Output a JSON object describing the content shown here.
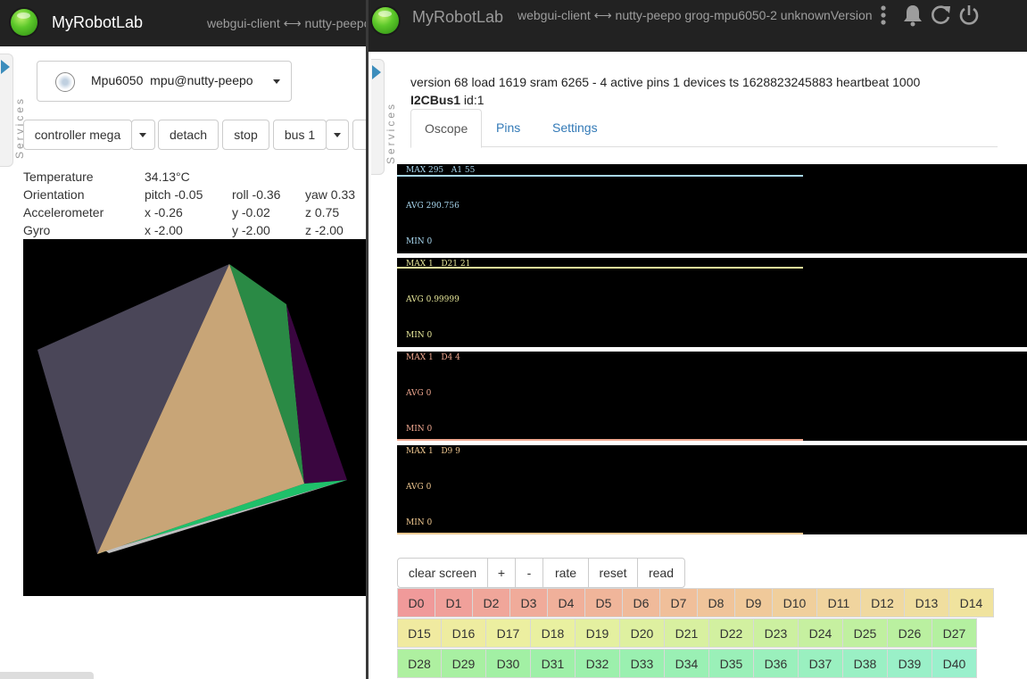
{
  "left": {
    "brand": "MyRobotLab",
    "nav_text": "webgui-client ⟷ nutty-peepo",
    "services_label": "Services",
    "service_select": {
      "name": "Mpu6050",
      "id": "mpu@nutty-peepo"
    },
    "controls": {
      "controller": "controller mega",
      "detach": "detach",
      "stop": "stop",
      "bus": "bus 1"
    },
    "sensors": [
      {
        "label": "Temperature",
        "v1": "34.13°C",
        "v2": "",
        "v3": ""
      },
      {
        "label": "Orientation",
        "v1": "pitch -0.05",
        "v2": "roll -0.36",
        "v3": "yaw 0.33"
      },
      {
        "label": "Accelerometer",
        "v1": "x -0.26",
        "v2": "y -0.02",
        "v3": "z 0.75"
      },
      {
        "label": "Gyro",
        "v1": "x -2.00",
        "v2": "y -2.00",
        "v3": "z -2.00"
      }
    ],
    "cube_colors": {
      "face_left": "#4a4658",
      "face_front": "#c8a577",
      "face_right": "#2a8a45",
      "face_dark": "#3a0640",
      "edge_green": "#1fc06a",
      "edge_grey": "#bfbfbf"
    }
  },
  "right": {
    "brand": "MyRobotLab",
    "nav_text": "webgui-client ⟷ nutty-peepo grog-mpu6050-2 unknownVersion",
    "icons": [
      "more-vert-icon",
      "bell-icon",
      "refresh-icon",
      "power-icon"
    ],
    "services_label": "Services",
    "info": "version 68 load 1619 sram 6265 - 4 active pins 1 devices ts 1628823245883 heartbeat 1000",
    "bus_name": "I2CBus1",
    "bus_id": "id:1",
    "tabs": [
      "Oscope",
      "Pins",
      "Settings"
    ],
    "active_tab": "Oscope",
    "scopes": [
      {
        "max": "MAX 295",
        "pin": "A1 55",
        "avg": "AVG 290.756",
        "min": "MIN 0",
        "color": "#a9d8f0",
        "level": 0.98
      },
      {
        "max": "MAX 1",
        "pin": "D21 21",
        "avg": "AVG 0.99999",
        "min": "MIN 0",
        "color": "#e8e89a",
        "level": 1.0
      },
      {
        "max": "MAX 1",
        "pin": "D4 4",
        "avg": "AVG 0",
        "min": "MIN 0",
        "color": "#f0a890",
        "level": 0.0
      },
      {
        "max": "MAX 1",
        "pin": "D9 9",
        "avg": "AVG 0",
        "min": "MIN 0",
        "color": "#f0c890",
        "level": 0.0
      }
    ],
    "toolbar": [
      "clear screen",
      "+",
      "-",
      "rate",
      "reset",
      "read"
    ],
    "pin_rows": [
      [
        "D0",
        "D1",
        "D2",
        "D3",
        "D4",
        "D5",
        "D6",
        "D7",
        "D8",
        "D9",
        "D10",
        "D11",
        "D12",
        "D13",
        "D14"
      ],
      [
        "D15",
        "D16",
        "D17",
        "D18",
        "D19",
        "D20",
        "D21",
        "D22",
        "D23",
        "D24",
        "D25",
        "D26",
        "D27"
      ],
      [
        "D28",
        "D29",
        "D30",
        "D31",
        "D32",
        "D33",
        "D34",
        "D35",
        "D36",
        "D37",
        "D38",
        "D39",
        "D40"
      ]
    ],
    "pin_colors": [
      [
        "#f09a9a",
        "#f0a09a",
        "#f0a69a",
        "#f0ab9a",
        "#f0b09a",
        "#f0b59a",
        "#f0ba9a",
        "#f0bf9a",
        "#f0c49a",
        "#f0c99a",
        "#f0cf9c",
        "#f0d49e",
        "#f0d9a0",
        "#f0de9f",
        "#f0e39e"
      ],
      [
        "#f0eaa0",
        "#eeeca0",
        "#ecefa0",
        "#e9f0a0",
        "#e4f0a0",
        "#def0a0",
        "#d8f0a0",
        "#d2f0a0",
        "#ccf0a0",
        "#c6f0a0",
        "#c0f0a0",
        "#baf0a0",
        "#b4f0a0"
      ],
      [
        "#aef0a0",
        "#a8f0a2",
        "#a2f0a4",
        "#9ef0a8",
        "#9cf0ac",
        "#9af0b0",
        "#9af0b4",
        "#9af0b8",
        "#9af0bc",
        "#9af0c0",
        "#9af0c4",
        "#9af0c8",
        "#9af0cc"
      ]
    ]
  }
}
